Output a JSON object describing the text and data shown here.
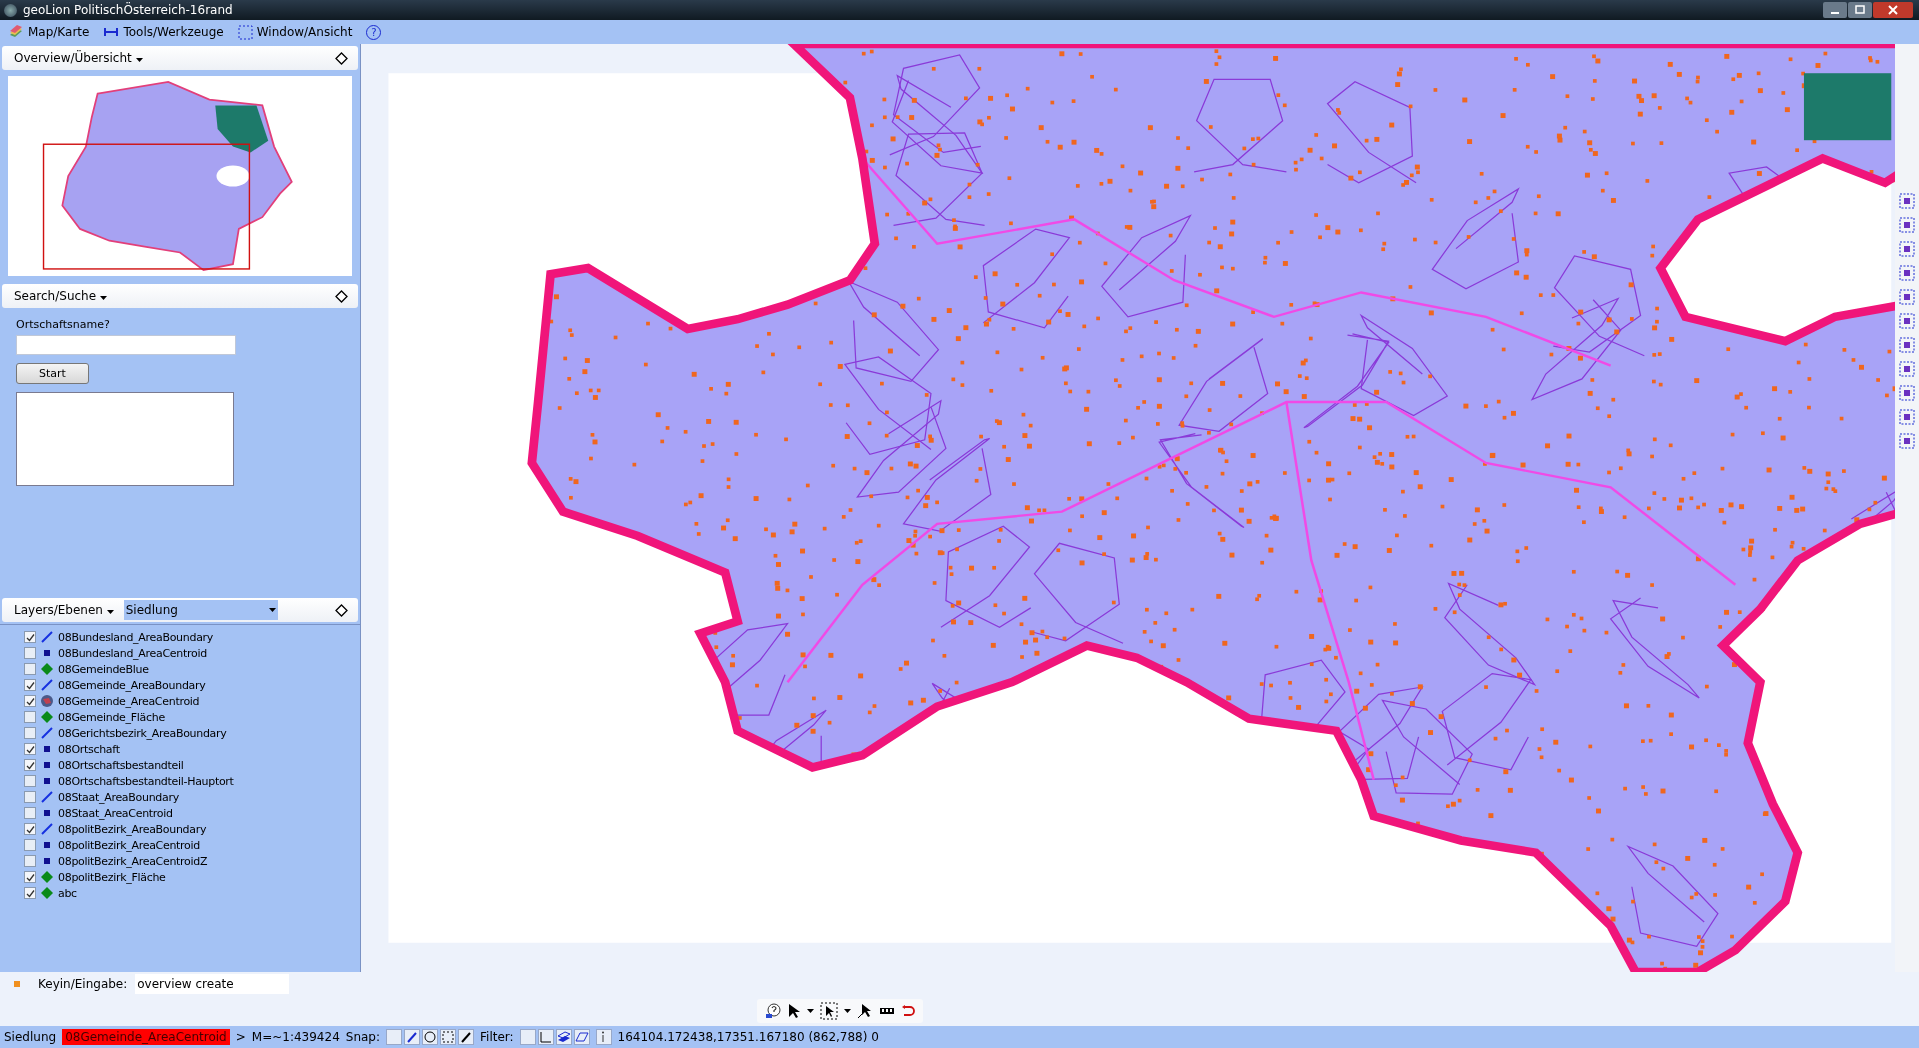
{
  "window": {
    "title": "geoLion PolitischÖsterreich-16rand"
  },
  "menu": [
    {
      "label": "Map/Karte",
      "kind": "layers"
    },
    {
      "label": "Tools/Werkzeuge",
      "kind": "measure"
    },
    {
      "label": "Window/Ansicht",
      "kind": "window"
    },
    {
      "label": "?",
      "kind": "help"
    }
  ],
  "overview": {
    "title": "Overview/Übersicht"
  },
  "search": {
    "title": "Search/Suche",
    "label": "Ortschaftsname?",
    "button": "Start"
  },
  "layers_panel": {
    "title": "Layers/Ebenen",
    "active_layer": "Siedlung"
  },
  "layers": [
    {
      "name": "08Bundesland_AreaBoundary",
      "kind": "line",
      "checked": true
    },
    {
      "name": "08Bundesland_AreaCentroid",
      "kind": "point",
      "checked": false
    },
    {
      "name": "08GemeindeBlue",
      "kind": "area",
      "checked": false
    },
    {
      "name": "08Gemeinde_AreaBoundary",
      "kind": "line",
      "checked": true
    },
    {
      "name": "08Gemeinde_AreaCentroid",
      "kind": "symbol",
      "checked": true
    },
    {
      "name": "08Gemeinde_Fläche",
      "kind": "area",
      "checked": false
    },
    {
      "name": "08Gerichtsbezirk_AreaBoundary",
      "kind": "line",
      "checked": false
    },
    {
      "name": "08Ortschaft",
      "kind": "point",
      "checked": true
    },
    {
      "name": "08Ortschaftsbestandteil",
      "kind": "point",
      "checked": true
    },
    {
      "name": "08Ortschaftsbestandteil-Hauptort",
      "kind": "point",
      "checked": false
    },
    {
      "name": "08Staat_AreaBoundary",
      "kind": "line",
      "checked": false
    },
    {
      "name": "08Staat_AreaCentroid",
      "kind": "point",
      "checked": false
    },
    {
      "name": "08politBezirk_AreaBoundary",
      "kind": "line",
      "checked": true
    },
    {
      "name": "08politBezirk_AreaCentroid",
      "kind": "point",
      "checked": false
    },
    {
      "name": "08politBezirk_AreaCentroidZ",
      "kind": "point",
      "checked": false
    },
    {
      "name": "08politBezirk_Fläche",
      "kind": "area",
      "checked": true
    },
    {
      "name": "abc",
      "kind": "area",
      "checked": true
    }
  ],
  "keyin": {
    "label": "Keyin/Eingabe:",
    "value": "overview create"
  },
  "status_bar": {
    "layer": "Siedlung",
    "selected_layer": "08Gemeinde_AreaCentroid",
    "separator": ">",
    "scale": "M=~1:439424",
    "snap_label": "Snap:",
    "filter_label": "Filter:",
    "coordinates": "164104.172438,17351.167180 (862,788) 0"
  }
}
